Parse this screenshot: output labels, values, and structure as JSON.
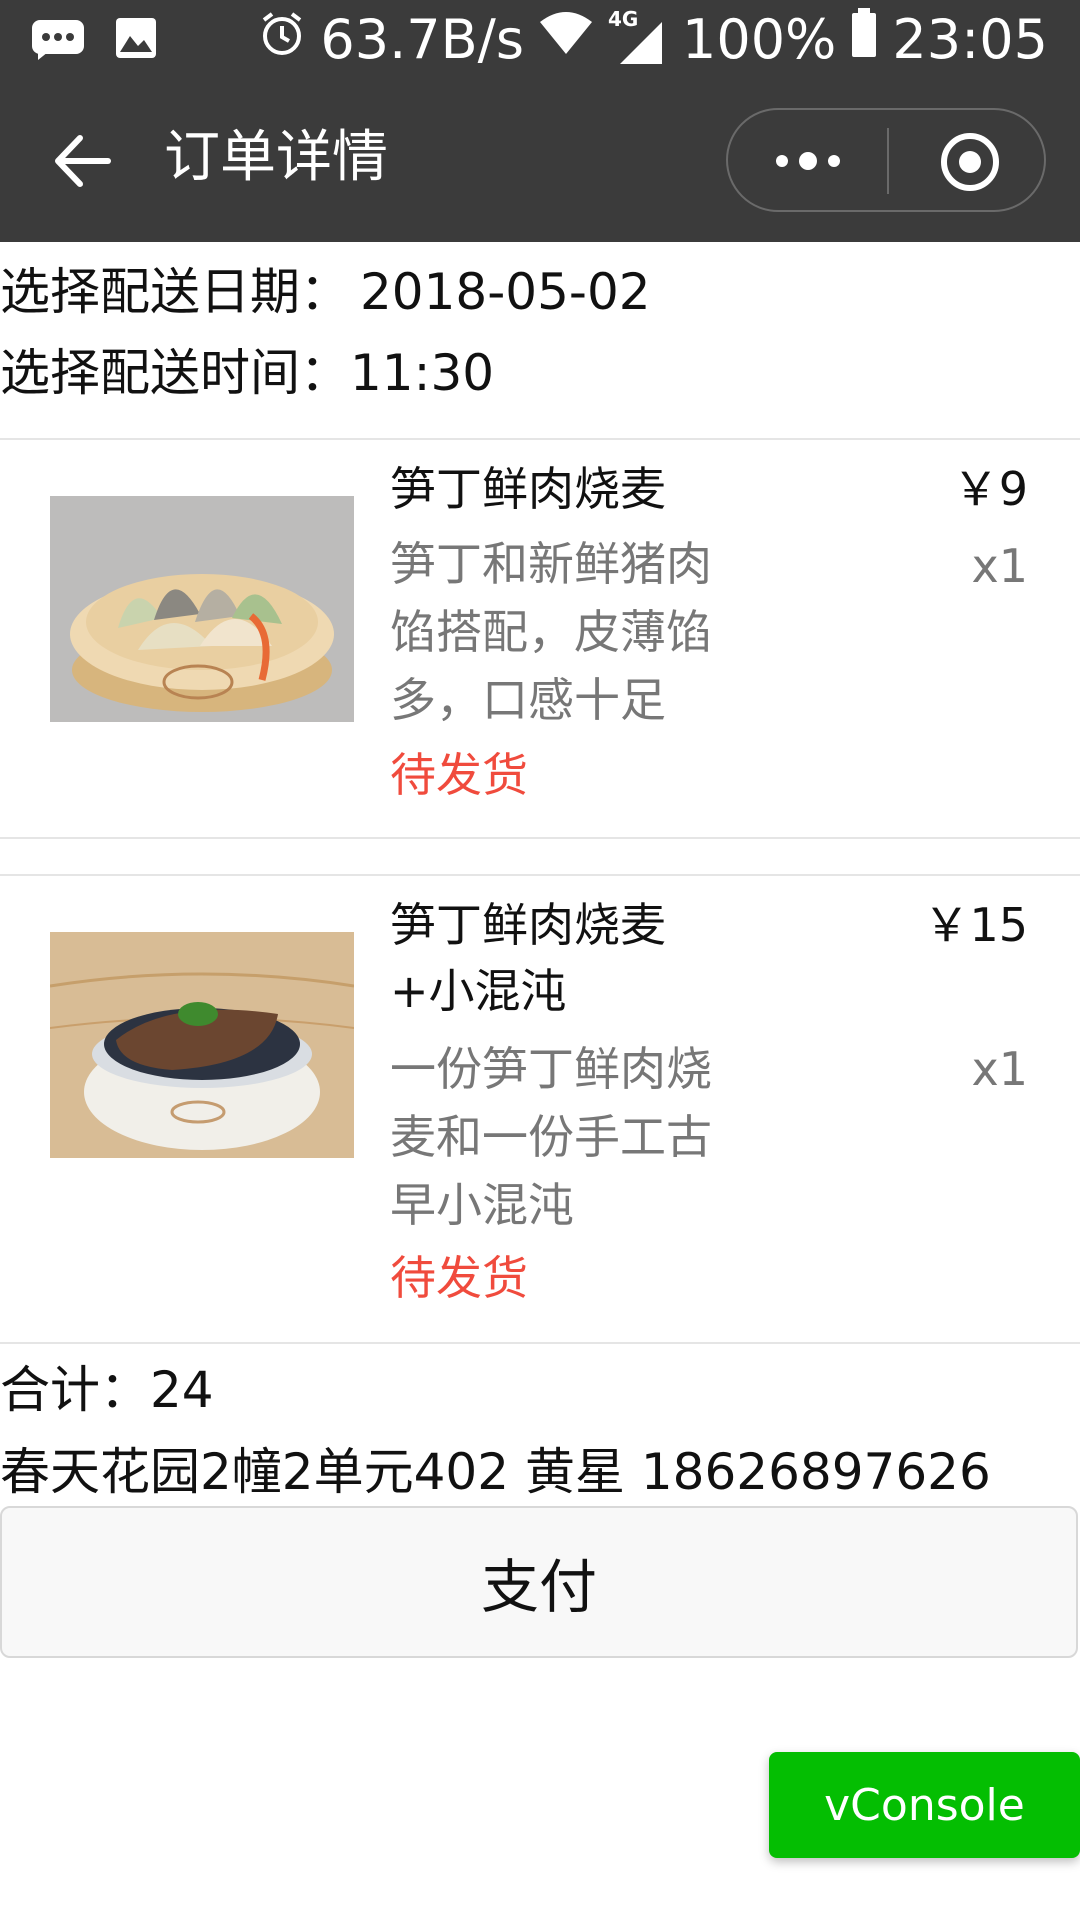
{
  "status_bar": {
    "speed": "63.7B/s",
    "network": "4G",
    "battery": "100%",
    "time": "23:05",
    "icons": [
      "message-icon",
      "image-icon",
      "alarm-icon",
      "wifi-icon",
      "signal-icon",
      "battery-icon"
    ]
  },
  "nav": {
    "title": "订单详情",
    "icons": [
      "back-arrow-icon",
      "more-icon",
      "target-icon"
    ]
  },
  "delivery": {
    "date_label": "选择配送日期：",
    "date_value": "2018-05-02",
    "time_label": "选择配送时间：",
    "time_value": "11:30"
  },
  "items": [
    {
      "name": "笋丁鲜肉烧麦",
      "desc": "笋丁和新鲜猪肉馅搭配，皮薄馅多，口感十足",
      "status": "待发货",
      "price": "￥9",
      "qty": "x1",
      "image": "shaomai-image"
    },
    {
      "name": "笋丁鲜肉烧麦+小混沌",
      "desc": "一份笋丁鲜肉烧麦和一份手工古早小混沌",
      "status": "待发货",
      "price": "￥15",
      "qty": "x1",
      "image": "shaomai-wonton-image"
    }
  ],
  "summary": {
    "total_label": "合计：",
    "total_value": "24",
    "address": "春天花园2幢2单元402 黄星 18626897626"
  },
  "actions": {
    "pay_label": "支付",
    "vconsole_label": "vConsole"
  },
  "colors": {
    "status_bar_bg": "#3b3b3b",
    "status_text": "#f04b3d",
    "vconsole_green": "#04be02"
  }
}
